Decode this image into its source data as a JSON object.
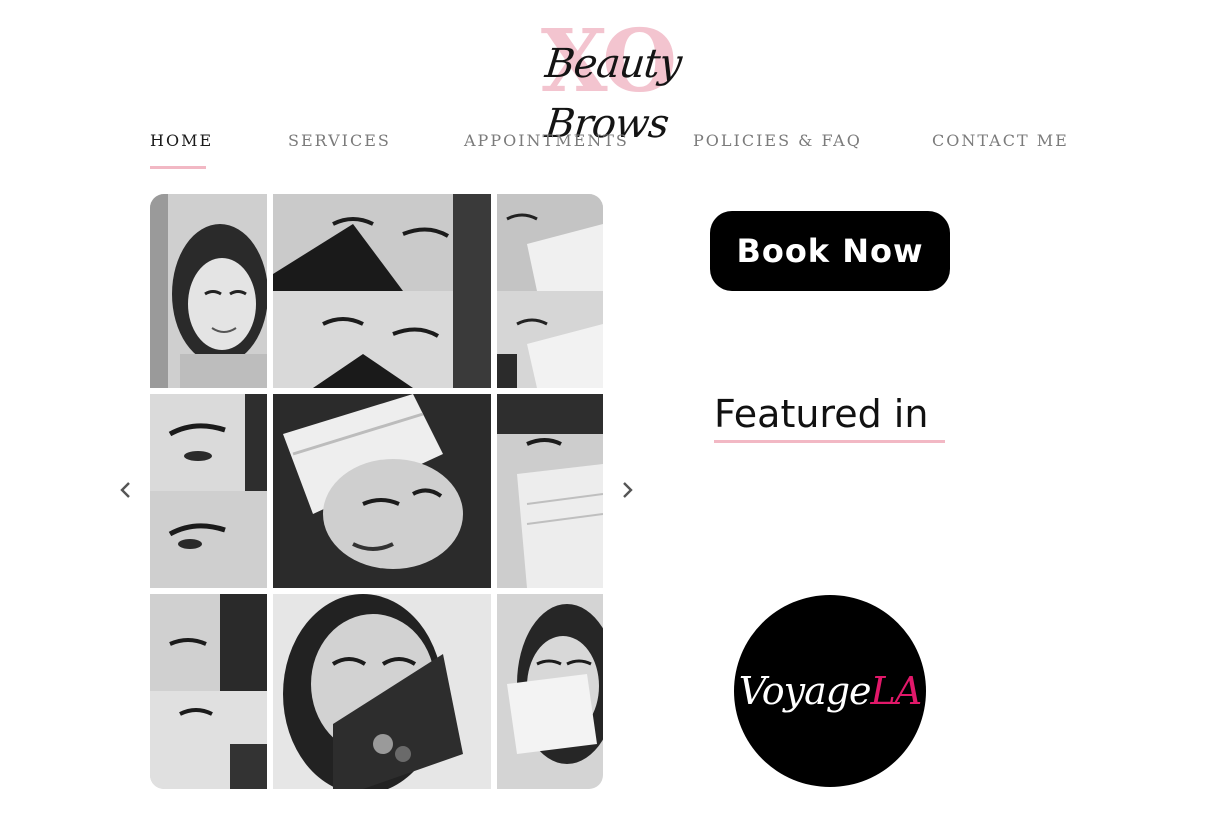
{
  "logo": {
    "mark": "XO",
    "script": "Beauty Brows",
    "colors": {
      "mark": "#f3c4cf",
      "script": "#141414"
    }
  },
  "nav": {
    "items": [
      {
        "label": "HOME",
        "active": true
      },
      {
        "label": "SERVICES",
        "active": false
      },
      {
        "label": "APPOINTMENTS",
        "active": false
      },
      {
        "label": "POLICIES & FAQ",
        "active": false
      },
      {
        "label": "CONTACT ME",
        "active": false
      }
    ],
    "underline_color": "#f2b8c4"
  },
  "gallery": {
    "prev_icon": "chevron-left-icon",
    "next_icon": "chevron-right-icon",
    "tile_count": 9
  },
  "cta": {
    "book_label": "Book Now",
    "bg_color": "#000000"
  },
  "featured": {
    "heading": "Featured in",
    "badge_text_white": "Voyage",
    "badge_text_pink": "LA",
    "accent_color": "#e2186a"
  }
}
